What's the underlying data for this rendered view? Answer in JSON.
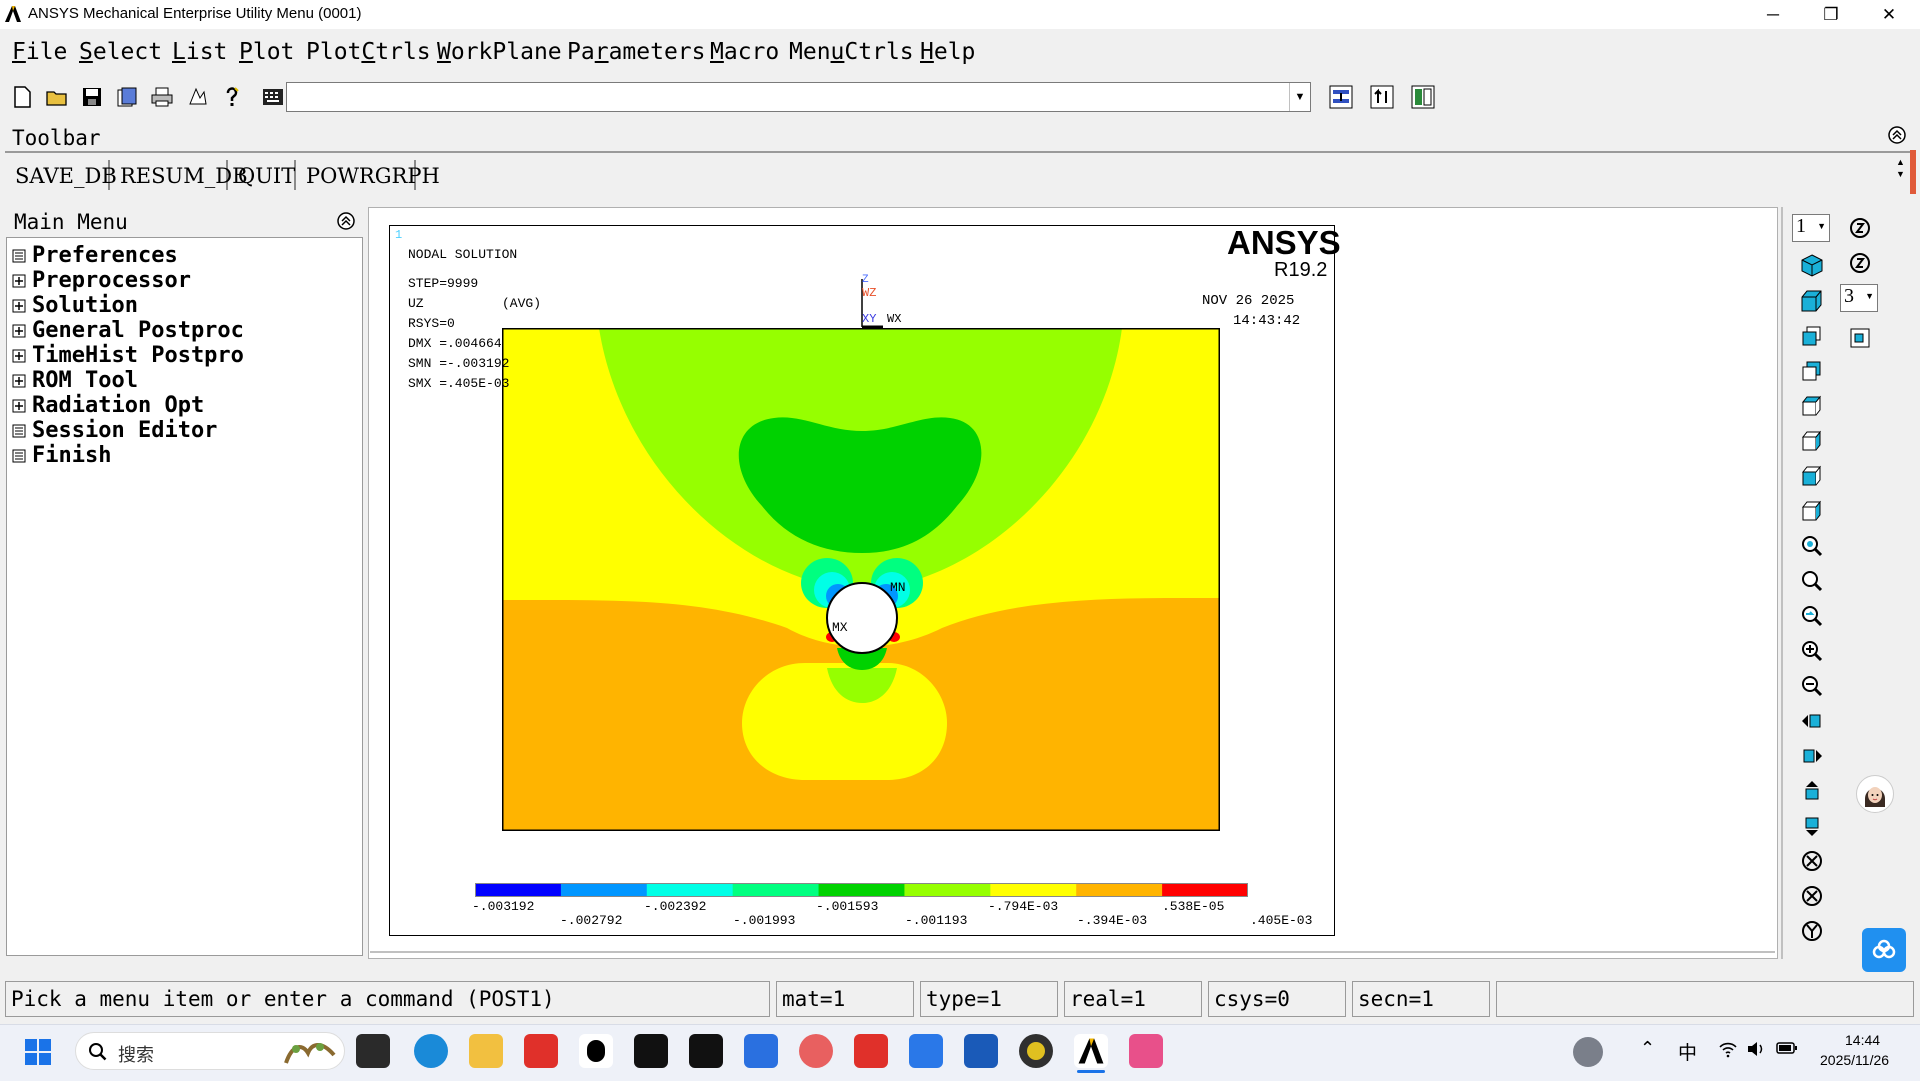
{
  "window": {
    "title": "ANSYS Mechanical Enterprise Utility Menu (0001)",
    "minimize_glyph": "─",
    "restore_glyph": "❐",
    "close_glyph": "✕"
  },
  "menu": [
    {
      "pre": "",
      "u": "F",
      "post": "ile"
    },
    {
      "pre": "",
      "u": "S",
      "post": "elect"
    },
    {
      "pre": "",
      "u": "L",
      "post": "ist"
    },
    {
      "pre": "",
      "u": "P",
      "post": "lot"
    },
    {
      "pre": "Plot",
      "u": "C",
      "post": "trls"
    },
    {
      "pre": "",
      "u": "W",
      "post": "orkPlane"
    },
    {
      "pre": "Pa",
      "u": "r",
      "post": "ameters"
    },
    {
      "pre": "",
      "u": "M",
      "post": "acro"
    },
    {
      "pre": "Men",
      "u": "u",
      "post": "Ctrls"
    },
    {
      "pre": "",
      "u": "H",
      "post": "elp"
    }
  ],
  "toolbar": {
    "label": "Toolbar",
    "buttons": [
      "SAVE_DB",
      "RESUM_DB",
      "QUIT",
      "POWRGRPH"
    ],
    "command_value": ""
  },
  "main_menu": {
    "title": "Main Menu",
    "items": [
      {
        "label": "Preferences",
        "icon": "panel-icon"
      },
      {
        "label": "Preprocessor",
        "icon": "plus-icon"
      },
      {
        "label": "Solution",
        "icon": "plus-icon"
      },
      {
        "label": "General Postproc",
        "icon": "plus-icon"
      },
      {
        "label": "TimeHist Postpro",
        "icon": "plus-icon"
      },
      {
        "label": "ROM Tool",
        "icon": "plus-icon"
      },
      {
        "label": "Radiation Opt",
        "icon": "plus-icon"
      },
      {
        "label": "Session Editor",
        "icon": "panel-icon"
      },
      {
        "label": "Finish",
        "icon": "panel-icon"
      }
    ]
  },
  "plot": {
    "window_number": "1",
    "header_lines": [
      "NODAL SOLUTION",
      "STEP=9999",
      "UZ",
      "RSYS=0",
      "DMX =.004664",
      "SMN =-.003192",
      "SMX =.405E-03"
    ],
    "avg_label": "(AVG)",
    "brand": "ANSYS",
    "version": "R19.2",
    "date": "NOV 26 2025",
    "time": "14:43:42",
    "triad": {
      "z": "Z",
      "wz": "WZ",
      "xy": "XY",
      "wx": "WX"
    },
    "min_label": "MN",
    "max_label": "MX",
    "contour_colors": [
      "#0000ff",
      "#0096ff",
      "#00ffe6",
      "#00ff80",
      "#00d200",
      "#96ff00",
      "#ffff00",
      "#ffb400",
      "#ff0000"
    ],
    "legend_top": [
      "-.003192",
      "-.002392",
      "-.001593",
      "-.794E-03",
      ".538E-05"
    ],
    "legend_bottom": [
      "-.002792",
      "-.001993",
      "-.001193",
      "-.394E-03",
      ".405E-03"
    ]
  },
  "right_toolbar": {
    "window_select": "1",
    "view_select": "3"
  },
  "status": {
    "prompt": "Pick a menu item or enter a command (POST1)",
    "mat": "mat=1",
    "type": "type=1",
    "real": "real=1",
    "csys": "csys=0",
    "secn": "secn=1"
  },
  "taskbar": {
    "search_placeholder": "搜索",
    "ime": "中",
    "time": "14:44",
    "date": "2025/11/26"
  }
}
